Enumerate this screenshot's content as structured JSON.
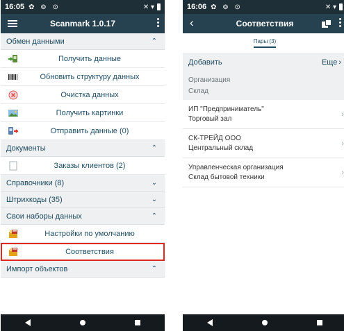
{
  "left": {
    "status": {
      "time": "16:05",
      "icons": "✿ ⊚ ⊙",
      "right": "✕ ▾"
    },
    "appbar": {
      "title": "Scanmark 1.0.17"
    },
    "sections": [
      {
        "title": "Обмен данными",
        "expanded": true,
        "items": [
          {
            "label": "Получить данные",
            "icon": "receive-data-icon"
          },
          {
            "label": "Обновить структуру данных",
            "icon": "barcode-icon"
          },
          {
            "label": "Очистка данных",
            "icon": "clear-icon"
          },
          {
            "label": "Получить картинки",
            "icon": "image-icon"
          },
          {
            "label": "Отправить данные (0)",
            "icon": "send-data-icon"
          }
        ]
      },
      {
        "title": "Документы",
        "expanded": true,
        "items": [
          {
            "label": "Заказы клиентов (2)",
            "icon": "document-icon"
          }
        ]
      },
      {
        "title": "Справочники (8)",
        "expanded": false,
        "items": []
      },
      {
        "title": "Штрихкоды (35)",
        "expanded": false,
        "items": []
      },
      {
        "title": "Свои наборы данных",
        "expanded": true,
        "items": [
          {
            "label": "Настройки по умолчанию",
            "icon": "settings-dataset-icon"
          },
          {
            "label": "Соответствия",
            "icon": "mapping-dataset-icon",
            "highlighted": true
          }
        ]
      },
      {
        "title": "Импорт объектов",
        "expanded": true,
        "items": []
      }
    ]
  },
  "right": {
    "status": {
      "time": "16:06",
      "icons": "✿ ⊚ ⊙",
      "right": "✕ ▾"
    },
    "appbar": {
      "title": "Соответствия"
    },
    "tab": "Пары (3)",
    "actions": {
      "add": "Добавить",
      "more": "Еще"
    },
    "header": {
      "org": "Организация",
      "warehouse": "Склад"
    },
    "pairs": [
      {
        "org": "ИП \"Предприниматель\"",
        "warehouse": "Торговый зал"
      },
      {
        "org": "СК-ТРЕЙД ООО",
        "warehouse": "Центральный склад"
      },
      {
        "org": "Управленческая организация",
        "warehouse": "Склад бытовой техники"
      }
    ]
  },
  "colors": {
    "appbar": "#26414f",
    "statusbar": "#1f2f38",
    "section_bg": "#eef0f1",
    "text_primary": "#1f4e66",
    "highlight": "#e0281f"
  }
}
